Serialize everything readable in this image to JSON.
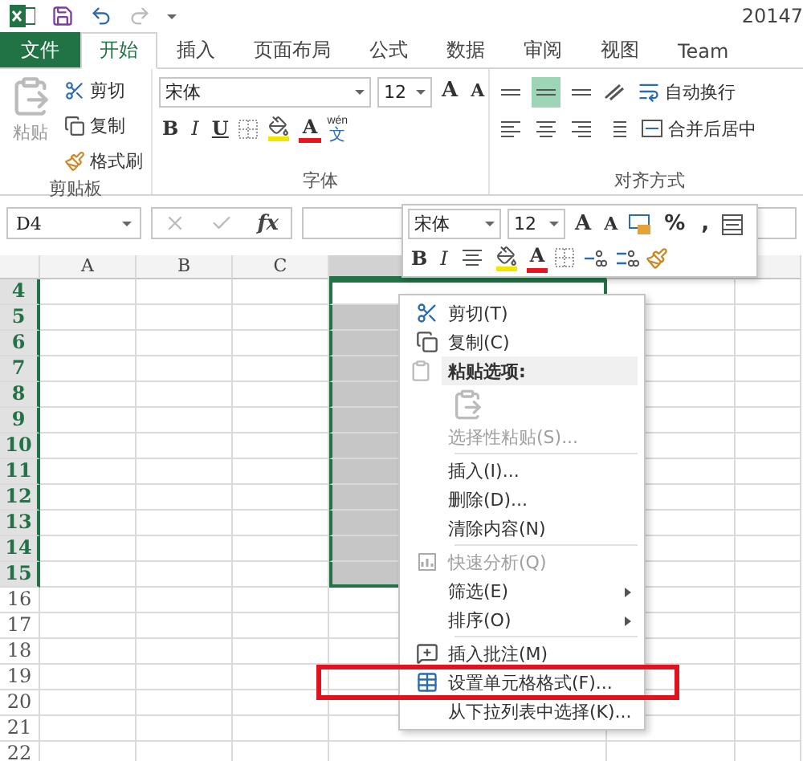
{
  "title_bar": {
    "title": "20147"
  },
  "tabs": [
    {
      "label": "文件",
      "kind": "file",
      "selected": false
    },
    {
      "label": "开始",
      "kind": "tab",
      "selected": true
    },
    {
      "label": "插入",
      "kind": "tab",
      "selected": false
    },
    {
      "label": "页面布局",
      "kind": "tab",
      "selected": false
    },
    {
      "label": "公式",
      "kind": "tab",
      "selected": false
    },
    {
      "label": "数据",
      "kind": "tab",
      "selected": false
    },
    {
      "label": "审阅",
      "kind": "tab",
      "selected": false
    },
    {
      "label": "视图",
      "kind": "tab",
      "selected": false
    },
    {
      "label": "Team",
      "kind": "tab",
      "selected": false
    }
  ],
  "ribbon": {
    "clipboard": {
      "paste": "粘贴",
      "cut": "剪切",
      "copy": "复制",
      "format_painter": "格式刷",
      "label": "剪贴板"
    },
    "font": {
      "name": "宋体",
      "size": "12",
      "grow": "A",
      "shrink": "A",
      "bold": "B",
      "italic": "I",
      "underline": "U",
      "font_color": "A",
      "phonetic_top": "wén",
      "phonetic_char": "文",
      "label": "字体"
    },
    "alignment": {
      "wrap": "自动换行",
      "merge": "合并后居中",
      "label": "对齐方式"
    }
  },
  "name_box": {
    "value": "D4"
  },
  "formula_bar": {
    "fx": "fx"
  },
  "sheet": {
    "columns": [
      {
        "label": "A",
        "selected": false
      },
      {
        "label": "B",
        "selected": false
      },
      {
        "label": "C",
        "selected": false
      },
      {
        "selected": true
      }
    ],
    "rows": [
      {
        "label": "4",
        "selected": true
      },
      {
        "label": "5",
        "selected": true
      },
      {
        "label": "6",
        "selected": true
      },
      {
        "label": "7",
        "selected": true
      },
      {
        "label": "8",
        "selected": true
      },
      {
        "label": "9",
        "selected": true
      },
      {
        "label": "10",
        "selected": true
      },
      {
        "label": "11",
        "selected": true
      },
      {
        "label": "12",
        "selected": true
      },
      {
        "label": "13",
        "selected": true
      },
      {
        "label": "14",
        "selected": true
      },
      {
        "label": "15",
        "selected": true
      },
      {
        "label": "16",
        "selected": false
      },
      {
        "label": "17",
        "selected": false
      },
      {
        "label": "18",
        "selected": false
      },
      {
        "label": "19",
        "selected": false
      },
      {
        "label": "20",
        "selected": false
      },
      {
        "label": "21",
        "selected": false
      },
      {
        "label": "22",
        "selected": false
      }
    ]
  },
  "mini_toolbar": {
    "font": "宋体",
    "size": "12",
    "grow": "A",
    "shrink": "A",
    "percent": "%",
    "comma": ",",
    "bold": "B",
    "italic": "I",
    "font_color": "A"
  },
  "context_menu": {
    "items": [
      {
        "kind": "item",
        "label": "剪切(T)",
        "disabled": false,
        "submenu": false,
        "highlighted": false
      },
      {
        "kind": "item",
        "label": "复制(C)",
        "disabled": false,
        "submenu": false,
        "highlighted": false
      },
      {
        "kind": "header",
        "label": "粘贴选项:"
      },
      {
        "kind": "paste-options"
      },
      {
        "kind": "item",
        "label": "选择性粘贴(S)...",
        "disabled": true,
        "submenu": false,
        "highlighted": false
      },
      {
        "kind": "separator"
      },
      {
        "kind": "item",
        "label": "插入(I)...",
        "disabled": false,
        "submenu": false,
        "highlighted": false
      },
      {
        "kind": "item",
        "label": "删除(D)...",
        "disabled": false,
        "submenu": false,
        "highlighted": false
      },
      {
        "kind": "item",
        "label": "清除内容(N)",
        "disabled": false,
        "submenu": false,
        "highlighted": false
      },
      {
        "kind": "separator"
      },
      {
        "kind": "item",
        "label": "快速分析(Q)",
        "disabled": true,
        "submenu": false,
        "highlighted": false
      },
      {
        "kind": "item",
        "label": "筛选(E)",
        "disabled": false,
        "submenu": true,
        "highlighted": false
      },
      {
        "kind": "item",
        "label": "排序(O)",
        "disabled": false,
        "submenu": true,
        "highlighted": false
      },
      {
        "kind": "separator"
      },
      {
        "kind": "item",
        "label": "插入批注(M)",
        "disabled": false,
        "submenu": false,
        "highlighted": false
      },
      {
        "kind": "item",
        "label": "设置单元格格式(F)...",
        "disabled": false,
        "submenu": false,
        "highlighted": true
      },
      {
        "kind": "item",
        "label": "从下拉列表中选择(K)...",
        "disabled": false,
        "submenu": false,
        "highlighted": false
      }
    ]
  }
}
